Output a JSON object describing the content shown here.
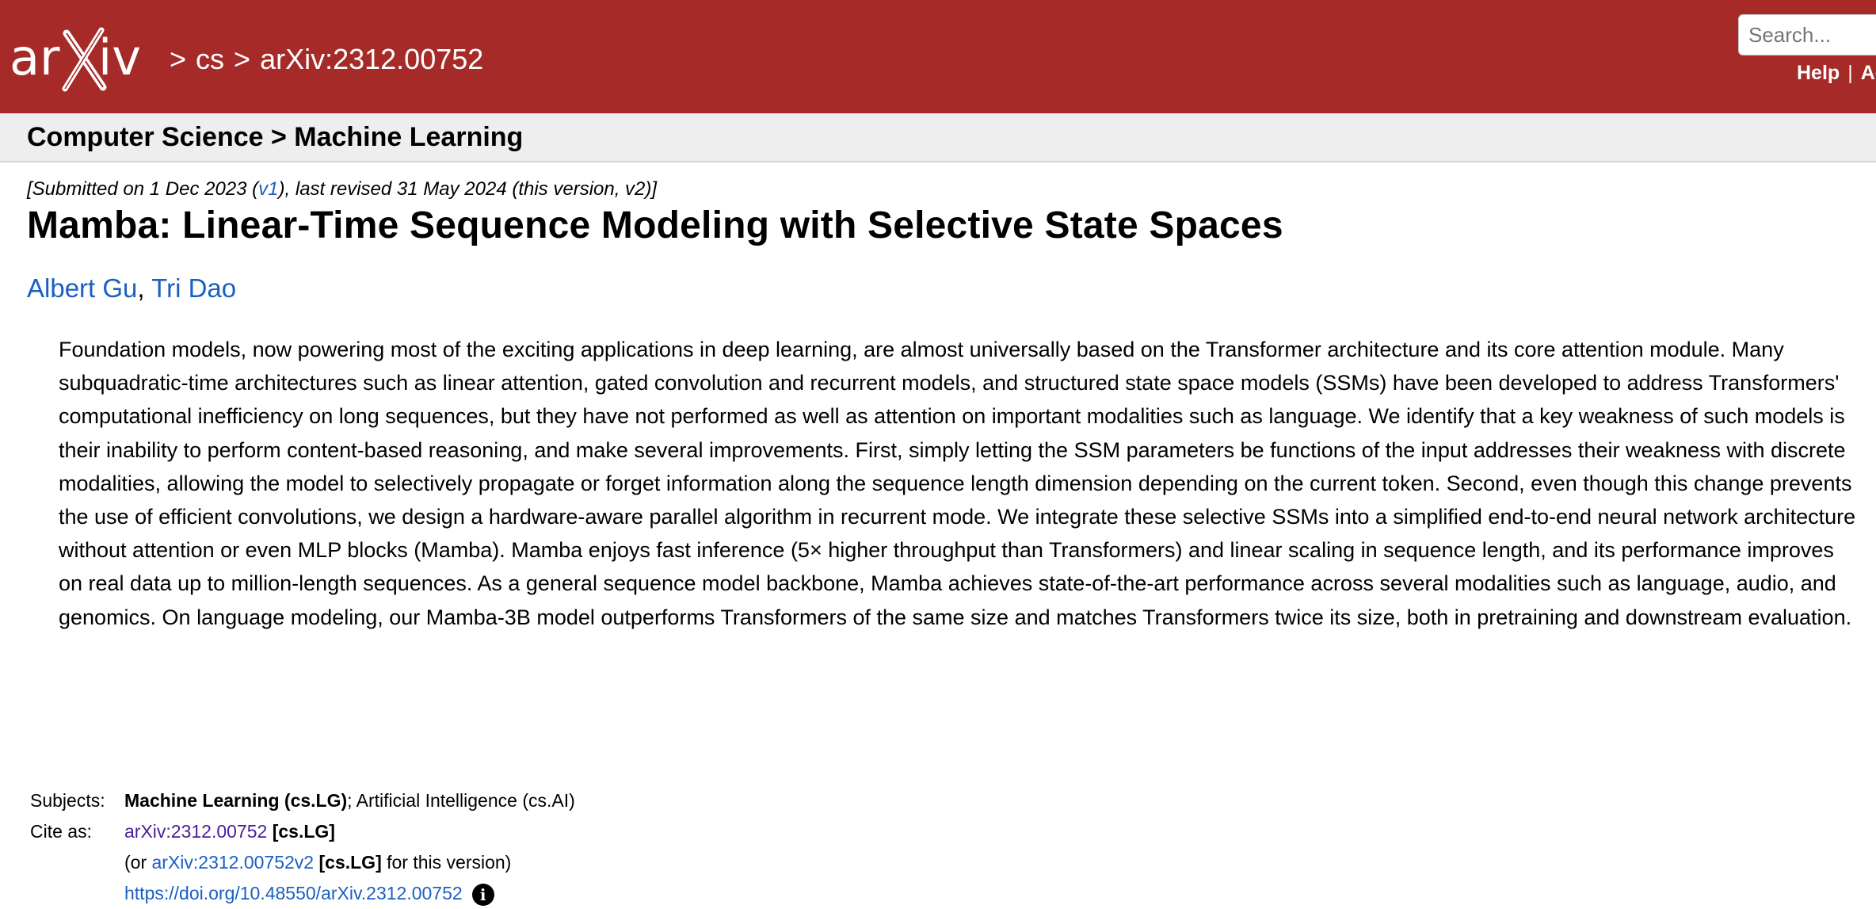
{
  "header": {
    "logo_text": "arXiv",
    "breadcrumb": {
      "sep": ">",
      "category": "cs",
      "paper_id": "arXiv:2312.00752"
    },
    "search_placeholder": "Search...",
    "help_label": "Help",
    "sep_bar": "|",
    "advanced_label": "Ad"
  },
  "subheader": {
    "text": "Computer Science > Machine Learning"
  },
  "paper": {
    "dateline_prefix": "[Submitted on 1 Dec 2023 (",
    "dateline_v1": "v1",
    "dateline_suffix": "), last revised 31 May 2024 (this version, v2)]",
    "title": "Mamba: Linear-Time Sequence Modeling with Selective State Spaces",
    "authors": [
      "Albert Gu",
      "Tri Dao"
    ],
    "author_sep": ", ",
    "abstract": "Foundation models, now powering most of the exciting applications in deep learning, are almost universally based on the Transformer architecture and its core attention module. Many subquadratic-time architectures such as linear attention, gated convolution and recurrent models, and structured state space models (SSMs) have been developed to address Transformers' computational inefficiency on long sequences, but they have not performed as well as attention on important modalities such as language. We identify that a key weakness of such models is their inability to perform content-based reasoning, and make several improvements. First, simply letting the SSM parameters be functions of the input addresses their weakness with discrete modalities, allowing the model to selectively propagate or forget information along the sequence length dimension depending on the current token. Second, even though this change prevents the use of efficient convolutions, we design a hardware-aware parallel algorithm in recurrent mode. We integrate these selective SSMs into a simplified end-to-end neural network architecture without attention or even MLP blocks (Mamba). Mamba enjoys fast inference (5× higher throughput than Transformers) and linear scaling in sequence length, and its performance improves on real data up to million-length sequences. As a general sequence model backbone, Mamba achieves state-of-the-art performance across several modalities such as language, audio, and genomics. On language modeling, our Mamba-3B model outperforms Transformers of the same size and matches Transformers twice its size, both in pretraining and downstream evaluation."
  },
  "metadata": {
    "subjects_label": "Subjects:",
    "subjects_primary": "Machine Learning (cs.LG)",
    "subjects_rest": "; Artificial Intelligence (cs.AI)",
    "cite_label": "Cite as:",
    "cite_id": "arXiv:2312.00752",
    "cite_cat": "[cs.LG]",
    "or_prefix": "(or ",
    "or_id": "arXiv:2312.00752v2",
    "or_cat": "[cs.LG]",
    "or_suffix": " for this version)",
    "doi": "https://doi.org/10.48550/arXiv.2312.00752",
    "info_icon": "info-icon"
  },
  "colors": {
    "header_bg": "#a52a28",
    "link_blue": "#1a5fc2",
    "link_purple": "#4b1c9a",
    "subheader_bg": "#eeeeee"
  }
}
